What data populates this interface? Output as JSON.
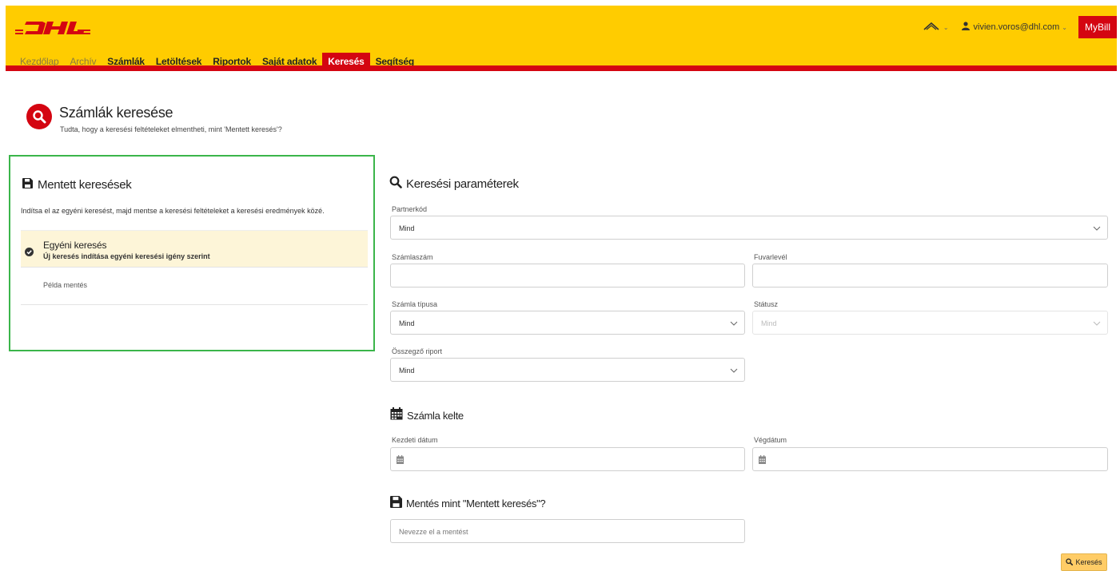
{
  "header": {
    "brand": "DHL",
    "user_email": "vivien.voros@dhl.com",
    "mybill_label": "MyBill",
    "language_icon": "flag-icon",
    "colors": {
      "brand_yellow": "#ffcc00",
      "brand_red": "#d40511"
    }
  },
  "nav": {
    "items": [
      {
        "label": "Kezdőlap",
        "state": "muted"
      },
      {
        "label": "Archív",
        "state": "muted"
      },
      {
        "label": "Számlák",
        "state": "normal"
      },
      {
        "label": "Letöltések",
        "state": "normal"
      },
      {
        "label": "Riportok",
        "state": "normal"
      },
      {
        "label": "Saját adatok",
        "state": "normal"
      },
      {
        "label": "Keresés",
        "state": "active"
      },
      {
        "label": "Segítség",
        "state": "normal"
      }
    ]
  },
  "page": {
    "title": "Számlák keresése",
    "subtitle": "Tudta, hogy a keresési feltételeket elmentheti, mint 'Mentett keresés'?"
  },
  "saved": {
    "title": "Mentett keresések",
    "description": "Indítsa el az egyéni keresést, majd mentse a keresési feltételeket a keresési eredmények közé.",
    "items": [
      {
        "title": "Egyéni keresés",
        "subtitle": "Új keresés indítása egyéni keresési igény szerint",
        "selected": true
      },
      {
        "title": "Példa mentés"
      }
    ]
  },
  "params": {
    "title": "Keresési paraméterek",
    "partnerkod": {
      "label": "Partnerkód",
      "value": "Mind"
    },
    "szamlaszam": {
      "label": "Számlaszám",
      "value": ""
    },
    "fuvarlevel": {
      "label": "Fuvarlevél",
      "value": ""
    },
    "szamla_tipusa": {
      "label": "Számla típusa",
      "value": "Mind"
    },
    "statusz": {
      "label": "Státusz",
      "value": "Mind"
    },
    "osszegzo": {
      "label": "Összegző riport",
      "value": "Mind"
    }
  },
  "date_section": {
    "title": "Számla kelte",
    "start": {
      "label": "Kezdeti dátum",
      "value": ""
    },
    "end": {
      "label": "Végdátum",
      "value": ""
    }
  },
  "save_section": {
    "title": "Mentés mint \"Mentett keresés\"?",
    "placeholder": "Nevezze el a mentést"
  },
  "search_button": "Keresés"
}
